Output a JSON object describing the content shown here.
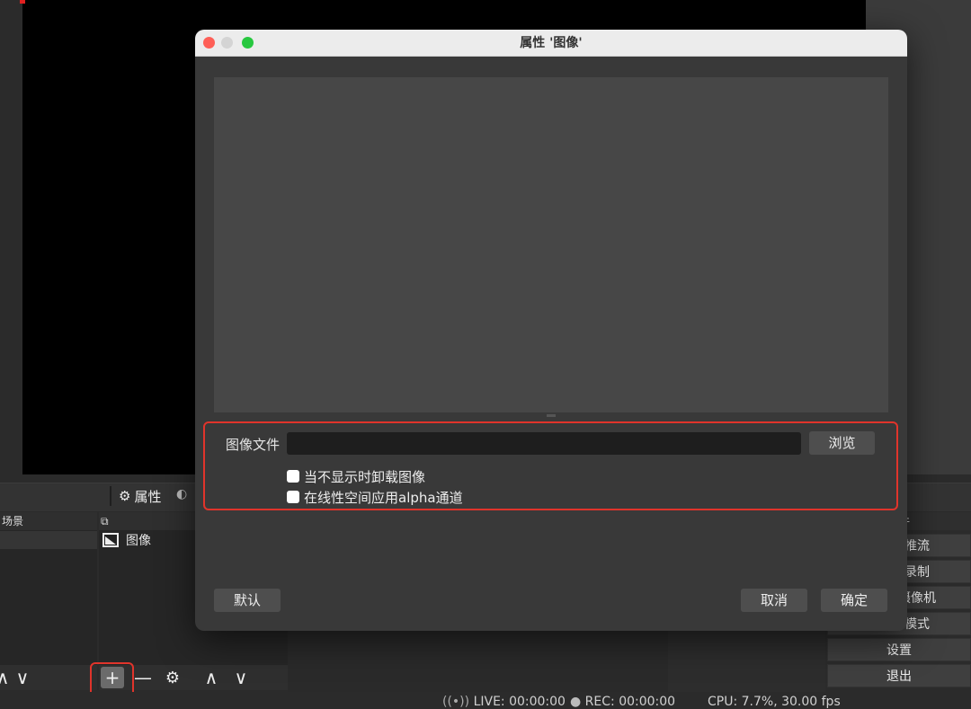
{
  "dialog": {
    "title": "属性 '图像'",
    "image_file_label": "图像文件",
    "image_file_value": "",
    "browse_label": "浏览",
    "unload_label": "当不显示时卸载图像",
    "unload_checked": false,
    "linear_alpha_label": "在线性空间应用alpha通道",
    "linear_alpha_checked": false,
    "defaults_label": "默认",
    "cancel_label": "取消",
    "ok_label": "确定"
  },
  "docks": {
    "properties_label": "属性",
    "scenes_header": "场景",
    "controls_header_partial": "件"
  },
  "sources": {
    "items": [
      {
        "label": "图像",
        "icon": "image-icon"
      }
    ]
  },
  "controls": {
    "buttons": [
      "推流",
      "录制",
      "摄像机",
      "模式",
      "设置",
      "退出"
    ]
  },
  "status": {
    "live": "LIVE: 00:00:00",
    "rec": "REC: 00:00:00",
    "cpu": "CPU: 7.7%, 30.00 fps"
  },
  "colors": {
    "highlight": "#e0342b",
    "traffic_close": "#fe5f57",
    "traffic_min": "#d4d4d4",
    "traffic_max": "#28c840"
  }
}
